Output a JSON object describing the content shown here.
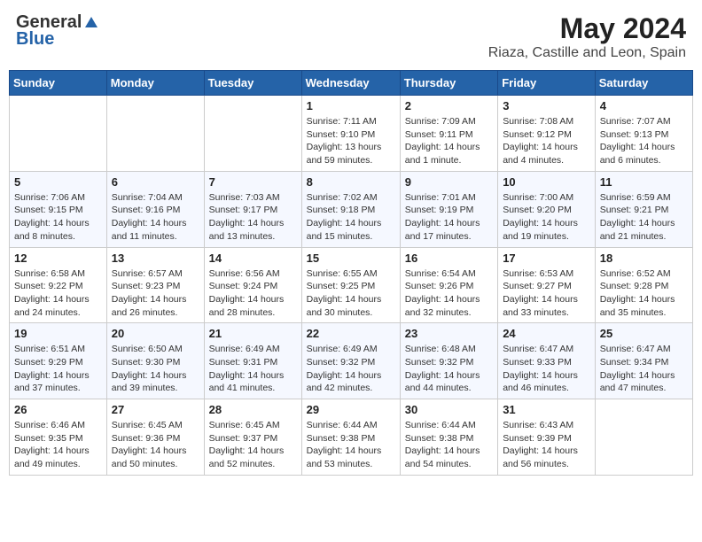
{
  "header": {
    "logo_general": "General",
    "logo_blue": "Blue",
    "title": "May 2024",
    "subtitle": "Riaza, Castille and Leon, Spain"
  },
  "weekdays": [
    "Sunday",
    "Monday",
    "Tuesday",
    "Wednesday",
    "Thursday",
    "Friday",
    "Saturday"
  ],
  "weeks": [
    [
      {
        "day": "",
        "sunrise": "",
        "sunset": "",
        "daylight": ""
      },
      {
        "day": "",
        "sunrise": "",
        "sunset": "",
        "daylight": ""
      },
      {
        "day": "",
        "sunrise": "",
        "sunset": "",
        "daylight": ""
      },
      {
        "day": "1",
        "sunrise": "Sunrise: 7:11 AM",
        "sunset": "Sunset: 9:10 PM",
        "daylight": "Daylight: 13 hours and 59 minutes."
      },
      {
        "day": "2",
        "sunrise": "Sunrise: 7:09 AM",
        "sunset": "Sunset: 9:11 PM",
        "daylight": "Daylight: 14 hours and 1 minute."
      },
      {
        "day": "3",
        "sunrise": "Sunrise: 7:08 AM",
        "sunset": "Sunset: 9:12 PM",
        "daylight": "Daylight: 14 hours and 4 minutes."
      },
      {
        "day": "4",
        "sunrise": "Sunrise: 7:07 AM",
        "sunset": "Sunset: 9:13 PM",
        "daylight": "Daylight: 14 hours and 6 minutes."
      }
    ],
    [
      {
        "day": "5",
        "sunrise": "Sunrise: 7:06 AM",
        "sunset": "Sunset: 9:15 PM",
        "daylight": "Daylight: 14 hours and 8 minutes."
      },
      {
        "day": "6",
        "sunrise": "Sunrise: 7:04 AM",
        "sunset": "Sunset: 9:16 PM",
        "daylight": "Daylight: 14 hours and 11 minutes."
      },
      {
        "day": "7",
        "sunrise": "Sunrise: 7:03 AM",
        "sunset": "Sunset: 9:17 PM",
        "daylight": "Daylight: 14 hours and 13 minutes."
      },
      {
        "day": "8",
        "sunrise": "Sunrise: 7:02 AM",
        "sunset": "Sunset: 9:18 PM",
        "daylight": "Daylight: 14 hours and 15 minutes."
      },
      {
        "day": "9",
        "sunrise": "Sunrise: 7:01 AM",
        "sunset": "Sunset: 9:19 PM",
        "daylight": "Daylight: 14 hours and 17 minutes."
      },
      {
        "day": "10",
        "sunrise": "Sunrise: 7:00 AM",
        "sunset": "Sunset: 9:20 PM",
        "daylight": "Daylight: 14 hours and 19 minutes."
      },
      {
        "day": "11",
        "sunrise": "Sunrise: 6:59 AM",
        "sunset": "Sunset: 9:21 PM",
        "daylight": "Daylight: 14 hours and 21 minutes."
      }
    ],
    [
      {
        "day": "12",
        "sunrise": "Sunrise: 6:58 AM",
        "sunset": "Sunset: 9:22 PM",
        "daylight": "Daylight: 14 hours and 24 minutes."
      },
      {
        "day": "13",
        "sunrise": "Sunrise: 6:57 AM",
        "sunset": "Sunset: 9:23 PM",
        "daylight": "Daylight: 14 hours and 26 minutes."
      },
      {
        "day": "14",
        "sunrise": "Sunrise: 6:56 AM",
        "sunset": "Sunset: 9:24 PM",
        "daylight": "Daylight: 14 hours and 28 minutes."
      },
      {
        "day": "15",
        "sunrise": "Sunrise: 6:55 AM",
        "sunset": "Sunset: 9:25 PM",
        "daylight": "Daylight: 14 hours and 30 minutes."
      },
      {
        "day": "16",
        "sunrise": "Sunrise: 6:54 AM",
        "sunset": "Sunset: 9:26 PM",
        "daylight": "Daylight: 14 hours and 32 minutes."
      },
      {
        "day": "17",
        "sunrise": "Sunrise: 6:53 AM",
        "sunset": "Sunset: 9:27 PM",
        "daylight": "Daylight: 14 hours and 33 minutes."
      },
      {
        "day": "18",
        "sunrise": "Sunrise: 6:52 AM",
        "sunset": "Sunset: 9:28 PM",
        "daylight": "Daylight: 14 hours and 35 minutes."
      }
    ],
    [
      {
        "day": "19",
        "sunrise": "Sunrise: 6:51 AM",
        "sunset": "Sunset: 9:29 PM",
        "daylight": "Daylight: 14 hours and 37 minutes."
      },
      {
        "day": "20",
        "sunrise": "Sunrise: 6:50 AM",
        "sunset": "Sunset: 9:30 PM",
        "daylight": "Daylight: 14 hours and 39 minutes."
      },
      {
        "day": "21",
        "sunrise": "Sunrise: 6:49 AM",
        "sunset": "Sunset: 9:31 PM",
        "daylight": "Daylight: 14 hours and 41 minutes."
      },
      {
        "day": "22",
        "sunrise": "Sunrise: 6:49 AM",
        "sunset": "Sunset: 9:32 PM",
        "daylight": "Daylight: 14 hours and 42 minutes."
      },
      {
        "day": "23",
        "sunrise": "Sunrise: 6:48 AM",
        "sunset": "Sunset: 9:32 PM",
        "daylight": "Daylight: 14 hours and 44 minutes."
      },
      {
        "day": "24",
        "sunrise": "Sunrise: 6:47 AM",
        "sunset": "Sunset: 9:33 PM",
        "daylight": "Daylight: 14 hours and 46 minutes."
      },
      {
        "day": "25",
        "sunrise": "Sunrise: 6:47 AM",
        "sunset": "Sunset: 9:34 PM",
        "daylight": "Daylight: 14 hours and 47 minutes."
      }
    ],
    [
      {
        "day": "26",
        "sunrise": "Sunrise: 6:46 AM",
        "sunset": "Sunset: 9:35 PM",
        "daylight": "Daylight: 14 hours and 49 minutes."
      },
      {
        "day": "27",
        "sunrise": "Sunrise: 6:45 AM",
        "sunset": "Sunset: 9:36 PM",
        "daylight": "Daylight: 14 hours and 50 minutes."
      },
      {
        "day": "28",
        "sunrise": "Sunrise: 6:45 AM",
        "sunset": "Sunset: 9:37 PM",
        "daylight": "Daylight: 14 hours and 52 minutes."
      },
      {
        "day": "29",
        "sunrise": "Sunrise: 6:44 AM",
        "sunset": "Sunset: 9:38 PM",
        "daylight": "Daylight: 14 hours and 53 minutes."
      },
      {
        "day": "30",
        "sunrise": "Sunrise: 6:44 AM",
        "sunset": "Sunset: 9:38 PM",
        "daylight": "Daylight: 14 hours and 54 minutes."
      },
      {
        "day": "31",
        "sunrise": "Sunrise: 6:43 AM",
        "sunset": "Sunset: 9:39 PM",
        "daylight": "Daylight: 14 hours and 56 minutes."
      },
      {
        "day": "",
        "sunrise": "",
        "sunset": "",
        "daylight": ""
      }
    ]
  ]
}
